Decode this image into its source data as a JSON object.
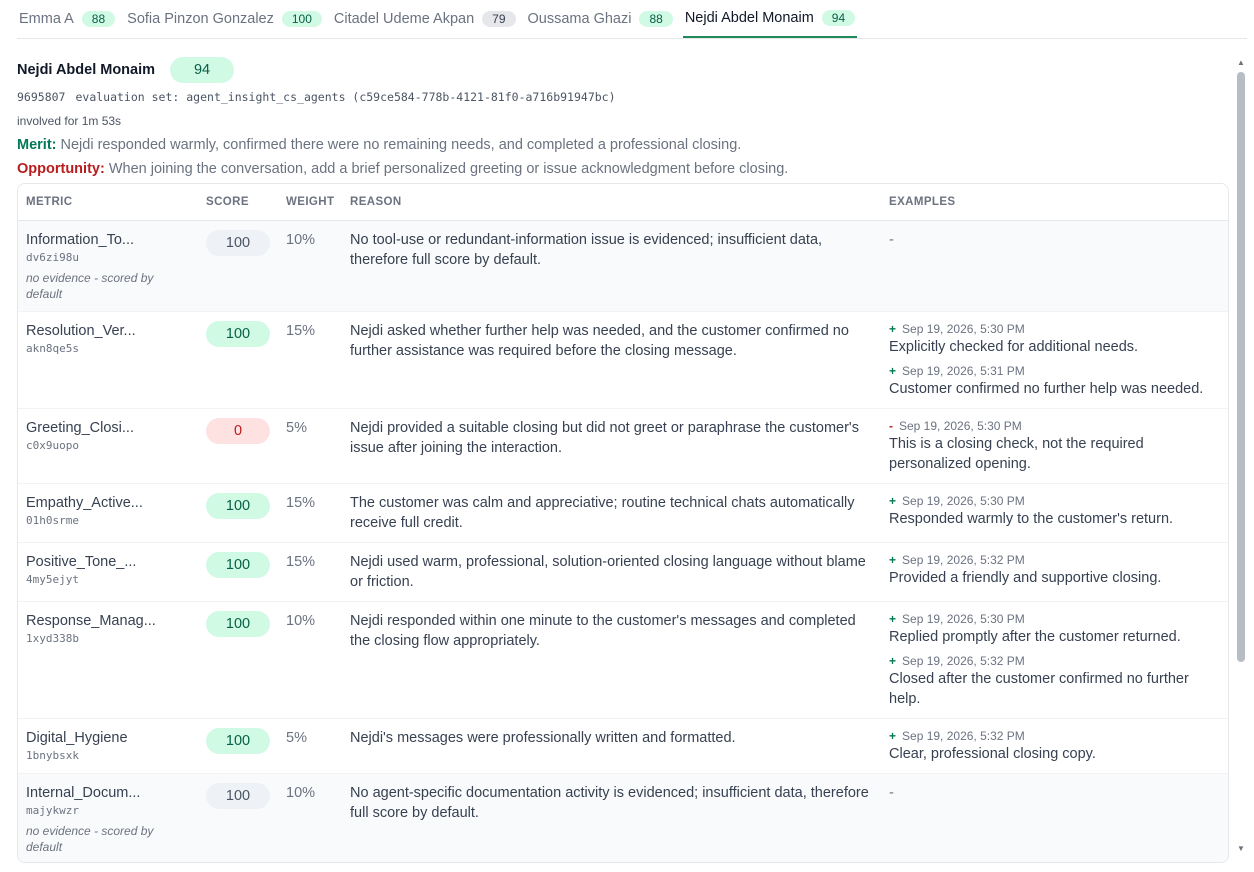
{
  "tabs": [
    {
      "label": "Emma A",
      "score": "88",
      "tone": "green"
    },
    {
      "label": "Sofia Pinzon Gonzalez",
      "score": "100",
      "tone": "green"
    },
    {
      "label": "Citadel Udeme Akpan",
      "score": "79",
      "tone": "gray"
    },
    {
      "label": "Oussama Ghazi",
      "score": "88",
      "tone": "green"
    },
    {
      "label": "Nejdi Abdel Monaim",
      "score": "94",
      "tone": "green",
      "active": true
    }
  ],
  "agent": {
    "name": "Nejdi Abdel Monaim",
    "score": "94",
    "id": "9695807",
    "evaluation_set": "evaluation set: agent_insight_cs_agents (c59ce584-778b-4121-81f0-a716b91947bc)",
    "involved": "involved for 1m 53s",
    "merit_label": "Merit:",
    "merit_text": "Nejdi responded warmly, confirmed there were no remaining needs, and completed a professional closing.",
    "opportunity_label": "Opportunity:",
    "opportunity_text": "When joining the conversation, add a brief personalized greeting or issue acknowledgment before closing."
  },
  "table": {
    "headers": {
      "metric": "METRIC",
      "score": "SCORE",
      "weight": "WEIGHT",
      "reason": "REASON",
      "examples": "EXAMPLES"
    },
    "rows": [
      {
        "name": "Information_To...",
        "id": "dv6zi98u",
        "note": "no evidence - scored by default",
        "score": "100",
        "tone": "gray",
        "weight": "10%",
        "reason": "No tool-use or redundant-information issue is evidenced; insufficient data, therefore full score by default.",
        "examples": [],
        "empty": "-"
      },
      {
        "name": "Resolution_Ver...",
        "id": "akn8qe5s",
        "note": "",
        "score": "100",
        "tone": "green",
        "weight": "15%",
        "reason": "Nejdi asked whether further help was needed, and the customer confirmed no further assistance was required before the closing message.",
        "examples": [
          {
            "sign": "+",
            "time": "Sep 19, 2026, 5:30 PM",
            "text": "Explicitly checked for additional needs."
          },
          {
            "sign": "+",
            "time": "Sep 19, 2026, 5:31 PM",
            "text": "Customer confirmed no further help was needed."
          }
        ]
      },
      {
        "name": "Greeting_Closi...",
        "id": "c0x9uopo",
        "note": "",
        "score": "0",
        "tone": "red",
        "weight": "5%",
        "reason": "Nejdi provided a suitable closing but did not greet or paraphrase the customer's issue after joining the interaction.",
        "examples": [
          {
            "sign": "-",
            "time": "Sep 19, 2026, 5:30 PM",
            "text": "This is a closing check, not the required personalized opening."
          }
        ]
      },
      {
        "name": "Empathy_Active...",
        "id": "01h0srme",
        "note": "",
        "score": "100",
        "tone": "green",
        "weight": "15%",
        "reason": "The customer was calm and appreciative; routine technical chats automatically receive full credit.",
        "examples": [
          {
            "sign": "+",
            "time": "Sep 19, 2026, 5:30 PM",
            "text": "Responded warmly to the customer's return."
          }
        ]
      },
      {
        "name": "Positive_Tone_...",
        "id": "4my5ejyt",
        "note": "",
        "score": "100",
        "tone": "green",
        "weight": "15%",
        "reason": "Nejdi used warm, professional, solution-oriented closing language without blame or friction.",
        "examples": [
          {
            "sign": "+",
            "time": "Sep 19, 2026, 5:32 PM",
            "text": "Provided a friendly and supportive closing."
          }
        ]
      },
      {
        "name": "Response_Manag...",
        "id": "1xyd338b",
        "note": "",
        "score": "100",
        "tone": "green",
        "weight": "10%",
        "reason": "Nejdi responded within one minute to the customer's messages and completed the closing flow appropriately.",
        "examples": [
          {
            "sign": "+",
            "time": "Sep 19, 2026, 5:30 PM",
            "text": "Replied promptly after the customer returned."
          },
          {
            "sign": "+",
            "time": "Sep 19, 2026, 5:32 PM",
            "text": "Closed after the customer confirmed no further help."
          }
        ]
      },
      {
        "name": "Digital_Hygiene",
        "id": "1bnybsxk",
        "note": "",
        "score": "100",
        "tone": "green",
        "weight": "5%",
        "reason": "Nejdi's messages were professionally written and formatted.",
        "examples": [
          {
            "sign": "+",
            "time": "Sep 19, 2026, 5:32 PM",
            "text": "Clear, professional closing copy."
          }
        ]
      },
      {
        "name": "Internal_Docum...",
        "id": "majykwzr",
        "note": "no evidence - scored by default",
        "score": "100",
        "tone": "gray",
        "weight": "10%",
        "reason": "No agent-specific documentation activity is evidenced; insufficient data, therefore full score by default.",
        "examples": [],
        "empty": "-"
      }
    ]
  },
  "colors": {
    "accent": "#1f8a5a",
    "merit": "#047857",
    "opportunity": "#b91c1c"
  }
}
